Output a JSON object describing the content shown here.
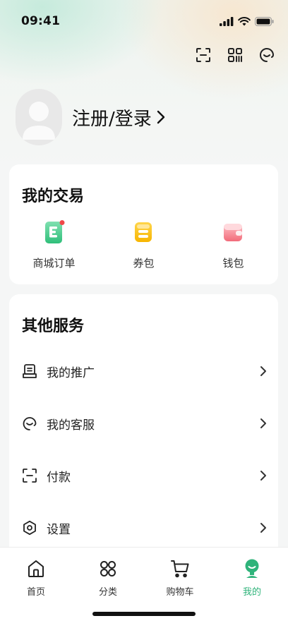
{
  "status_bar": {
    "time": "09:41"
  },
  "top_actions": [
    {
      "icon": "scan-icon"
    },
    {
      "icon": "qrcode-icon"
    },
    {
      "icon": "customer-service-icon"
    }
  ],
  "profile": {
    "login_text": "注册/登录"
  },
  "trade": {
    "title": "我的交易",
    "items": [
      {
        "label": "商城订单",
        "icon": "order-icon"
      },
      {
        "label": "券包",
        "icon": "coupon-icon"
      },
      {
        "label": "钱包",
        "icon": "wallet-icon"
      }
    ]
  },
  "services": {
    "title": "其他服务",
    "items": [
      {
        "label": "我的推广",
        "icon": "promotion-icon"
      },
      {
        "label": "我的客服",
        "icon": "customer-service-icon"
      },
      {
        "label": "付款",
        "icon": "scan-pay-icon"
      },
      {
        "label": "设置",
        "icon": "settings-icon"
      }
    ]
  },
  "tabbar": {
    "items": [
      {
        "label": "首页",
        "icon": "home-icon"
      },
      {
        "label": "分类",
        "icon": "category-icon"
      },
      {
        "label": "购物车",
        "icon": "cart-icon"
      },
      {
        "label": "我的",
        "icon": "profile-icon",
        "active": true
      }
    ]
  },
  "colors": {
    "accent": "#2fb37a"
  }
}
